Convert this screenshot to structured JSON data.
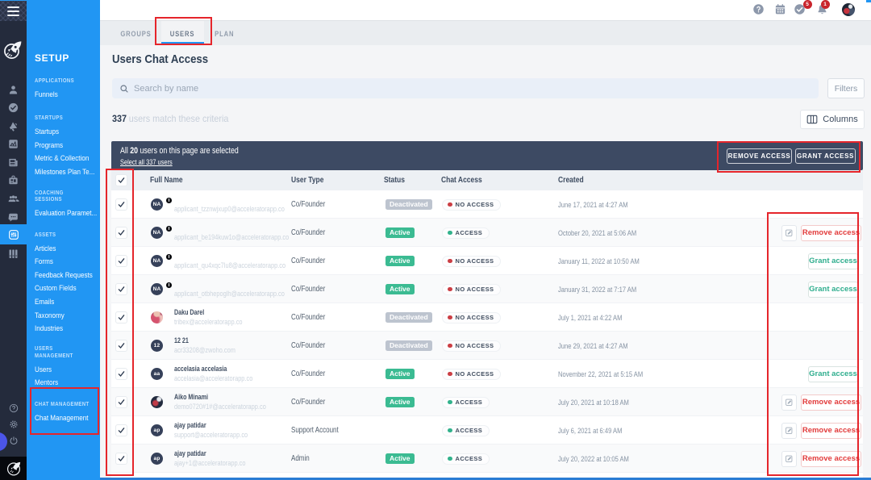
{
  "colors": {
    "sidebar_blue": "#2196f3",
    "annotation_red": "#e5252b",
    "selection_bar": "#3d4a63",
    "status_active": "#3bbb92",
    "status_deactivated": "#bdc4cf",
    "access_dot_green": "#32b28c",
    "access_dot_red": "#cb3e44",
    "remove_red": "#e23b3b",
    "grant_teal": "#2fae8e",
    "badge_red": "#c9252d"
  },
  "rail": {
    "icons": [
      "hamburger",
      "logo-rocket",
      "user",
      "check-circle",
      "megaphone",
      "chart",
      "news",
      "briefcase",
      "people",
      "chat",
      "sliders",
      "bars",
      "help",
      "gear",
      "power",
      "intercom",
      "compass"
    ],
    "selected_icon": "sliders"
  },
  "sidebar": {
    "title": "SETUP",
    "sections": [
      {
        "label": "APPLICATIONS",
        "items": [
          "Funnels"
        ]
      },
      {
        "label": "STARTUPS",
        "items": [
          "Startups",
          "Programs",
          "Metric & Collection",
          "Milestones Plan Te..."
        ]
      },
      {
        "label": "COACHING SESSIONS",
        "items": [
          "Evaluation Paramet..."
        ]
      },
      {
        "label": "ASSETS",
        "items": [
          "Articles",
          "Forms",
          "Feedback Requests",
          "Custom Fields",
          "Emails",
          "Taxonomy",
          "Industries"
        ]
      },
      {
        "label": "USERS MANAGEMENT",
        "items": [
          "Users",
          "Mentors"
        ]
      },
      {
        "label": "CHAT MANAGEMENT",
        "items": [
          "Chat Management"
        ]
      }
    ],
    "active_item": "Chat Management"
  },
  "topbar": {
    "task_badge": "5",
    "notification_badge": "1"
  },
  "tabs": [
    {
      "label": "GROUPS",
      "active": false
    },
    {
      "label": "USERS",
      "active": true
    },
    {
      "label": "PLAN",
      "active": false
    }
  ],
  "page": {
    "title": "Users Chat Access",
    "search_placeholder": "Search by name",
    "filters_label": "Filters",
    "match_count": "337",
    "match_text": "users match these criteria",
    "columns_label": "Columns"
  },
  "selection_bar": {
    "text_prefix": "All",
    "selected_count": "20",
    "text_suffix": "users on this page are selected",
    "select_all_label": "Select all 337 users",
    "remove_access_label": "REMOVE ACCESS",
    "grant_access_label": "GRANT ACCESS"
  },
  "table": {
    "headers": [
      "Full Name",
      "User Type",
      "Status",
      "Chat Access",
      "Created"
    ],
    "action_labels": {
      "remove": "Remove access",
      "grant": "Grant access"
    },
    "rows": [
      {
        "avatar": "NA",
        "avatar_type": "initials",
        "flagged": true,
        "name": "",
        "email": "applicant_tzznwjxup0@acceleratorapp.co",
        "user_type": "Co/Founder",
        "status": "Deactivated",
        "access": "NO ACCESS",
        "created": "June 17, 2021 at 4:27 AM",
        "actions": []
      },
      {
        "avatar": "NA",
        "avatar_type": "initials",
        "flagged": true,
        "name": "",
        "email": "applicant_be194kuw1o@acceleratorapp.co",
        "user_type": "Co/Founder",
        "status": "Active",
        "access": "ACCESS",
        "created": "October 20, 2021 at 5:06 AM",
        "actions": [
          "edit",
          "remove"
        ]
      },
      {
        "avatar": "NA",
        "avatar_type": "initials",
        "flagged": true,
        "name": "",
        "email": "applicant_qu4xqc7lu8@acceleratorapp.co",
        "user_type": "Co/Founder",
        "status": "Active",
        "access": "NO ACCESS",
        "created": "January 11, 2022 at 10:50 AM",
        "actions": [
          "grant"
        ]
      },
      {
        "avatar": "NA",
        "avatar_type": "initials",
        "flagged": true,
        "name": "",
        "email": "applicant_otbhepoglh@acceleratorapp.co",
        "user_type": "Co/Founder",
        "status": "Active",
        "access": "NO ACCESS",
        "created": "January 31, 2022 at 7:17 AM",
        "actions": [
          "grant"
        ]
      },
      {
        "avatar": "",
        "avatar_type": "photo-pink",
        "flagged": false,
        "name": "Daku Darel",
        "email": "tribex@acceleratorapp.co",
        "user_type": "Co/Founder",
        "status": "Deactivated",
        "access": "NO ACCESS",
        "created": "July 1, 2021 at 4:22 AM",
        "actions": []
      },
      {
        "avatar": "12",
        "avatar_type": "initials",
        "flagged": false,
        "name": "12 21",
        "email": "acr33208@zwoho.com",
        "user_type": "Co/Founder",
        "status": "Deactivated",
        "access": "NO ACCESS",
        "created": "June 29, 2021 at 4:27 AM",
        "actions": []
      },
      {
        "avatar": "aa",
        "avatar_type": "initials",
        "flagged": false,
        "name": "accelasia accelasia",
        "email": "accelasia@acceleratorapp.co",
        "user_type": "Co/Founder",
        "status": "Active",
        "access": "NO ACCESS",
        "created": "November 22, 2021 at 5:15 AM",
        "actions": [
          "grant"
        ]
      },
      {
        "avatar": "",
        "avatar_type": "photo-dark",
        "flagged": false,
        "name": "Aiko Minami",
        "email": "demo0720#1#@acceleratorapp.co",
        "user_type": "Co/Founder",
        "status": "Active",
        "access": "ACCESS",
        "created": "July 20, 2021 at 10:18 AM",
        "actions": [
          "edit",
          "remove"
        ]
      },
      {
        "avatar": "ap",
        "avatar_type": "initials",
        "flagged": false,
        "name": "ajay patidar",
        "email": "support@acceleratorapp.co",
        "user_type": "Support Account",
        "status": "",
        "access": "ACCESS",
        "created": "July 6, 2021 at 6:49 AM",
        "actions": [
          "edit",
          "remove"
        ]
      },
      {
        "avatar": "ap",
        "avatar_type": "initials",
        "flagged": false,
        "name": "ajay patidar",
        "email": "ajay+1@acceleratorapp.co",
        "user_type": "Admin",
        "status": "Active",
        "access": "ACCESS",
        "created": "July 20, 2022 at 10:05 AM",
        "actions": [
          "edit",
          "remove"
        ]
      }
    ]
  },
  "annotations": [
    "users-tab",
    "bulk-action-buttons",
    "checkbox-column",
    "row-actions-column",
    "chat-management-section"
  ]
}
